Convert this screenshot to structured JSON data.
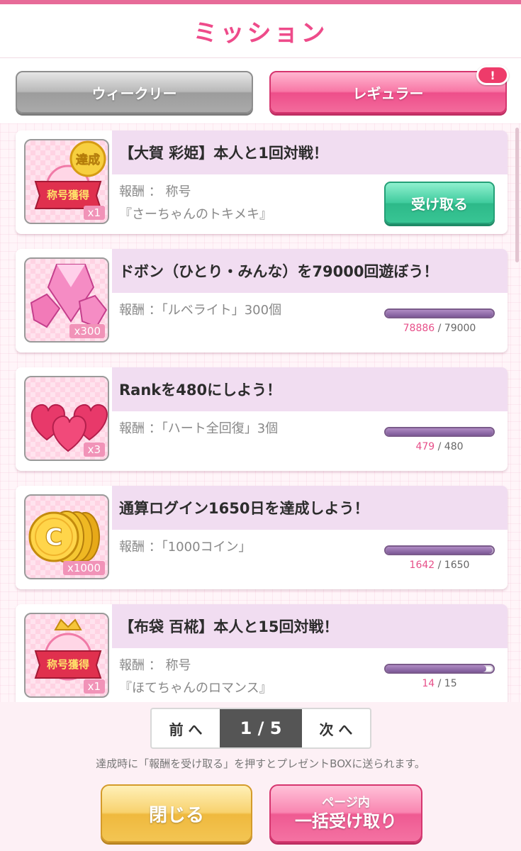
{
  "header": {
    "title": "ミッション"
  },
  "tabs": {
    "weekly": "ウィークリー",
    "regular": "レギュラー",
    "alert_badge": "!"
  },
  "missions": [
    {
      "title": "【大賀 彩姫】本人と1回対戦！",
      "reward_prefix": "報酬 ： 称号",
      "reward_line2": "『さーちゃんのトキメキ』",
      "quantity": "x1",
      "icon": "title-ribbon-icon",
      "completed_stamp": "達成",
      "action": "受け取る"
    },
    {
      "title": "ドボン（ひとり・みんな）を79000回遊ぼう！",
      "reward_prefix": "報酬 ：「ルベライト」300個",
      "quantity": "x300",
      "icon": "rubellite-gem-icon",
      "progress": {
        "current": "78886",
        "total": "/ 79000",
        "ratio": 0.9986
      }
    },
    {
      "title": "Rankを480にしよう！",
      "reward_prefix": "報酬 ：「ハート全回復」3個",
      "quantity": "x3",
      "icon": "hearts-icon",
      "progress": {
        "current": "479",
        "total": "/ 480",
        "ratio": 0.9979
      }
    },
    {
      "title": "通算ログイン1650日を達成しよう！",
      "reward_prefix": "報酬 ：「1000コイン」",
      "quantity": "x1000",
      "icon": "coins-icon",
      "progress": {
        "current": "1642",
        "total": "/ 1650",
        "ratio": 0.9952
      }
    },
    {
      "title": "【布袋 百椛】本人と15回対戦！",
      "reward_prefix": "報酬 ： 称号",
      "reward_line2": "『ほてちゃんのロマンス』",
      "quantity": "x1",
      "icon": "title-ribbon-icon",
      "progress": {
        "current": "14",
        "total": "/ 15",
        "ratio": 0.9333
      }
    }
  ],
  "ribbon_text": "称号獲得",
  "coin_letter": "C",
  "pager": {
    "prev": "前 へ",
    "page": "1 / 5",
    "next": "次 へ"
  },
  "footer_note": "達成時に「報酬を受け取る」を押すとプレゼントBOXに送られます。",
  "buttons": {
    "close": "閉じる",
    "bulk_small": "ページ内",
    "bulk_big": "一括受け取り"
  },
  "colors": {
    "accent": "#ee4b8a",
    "claim": "#3fcb9d",
    "progress_current": "#e7508a"
  }
}
